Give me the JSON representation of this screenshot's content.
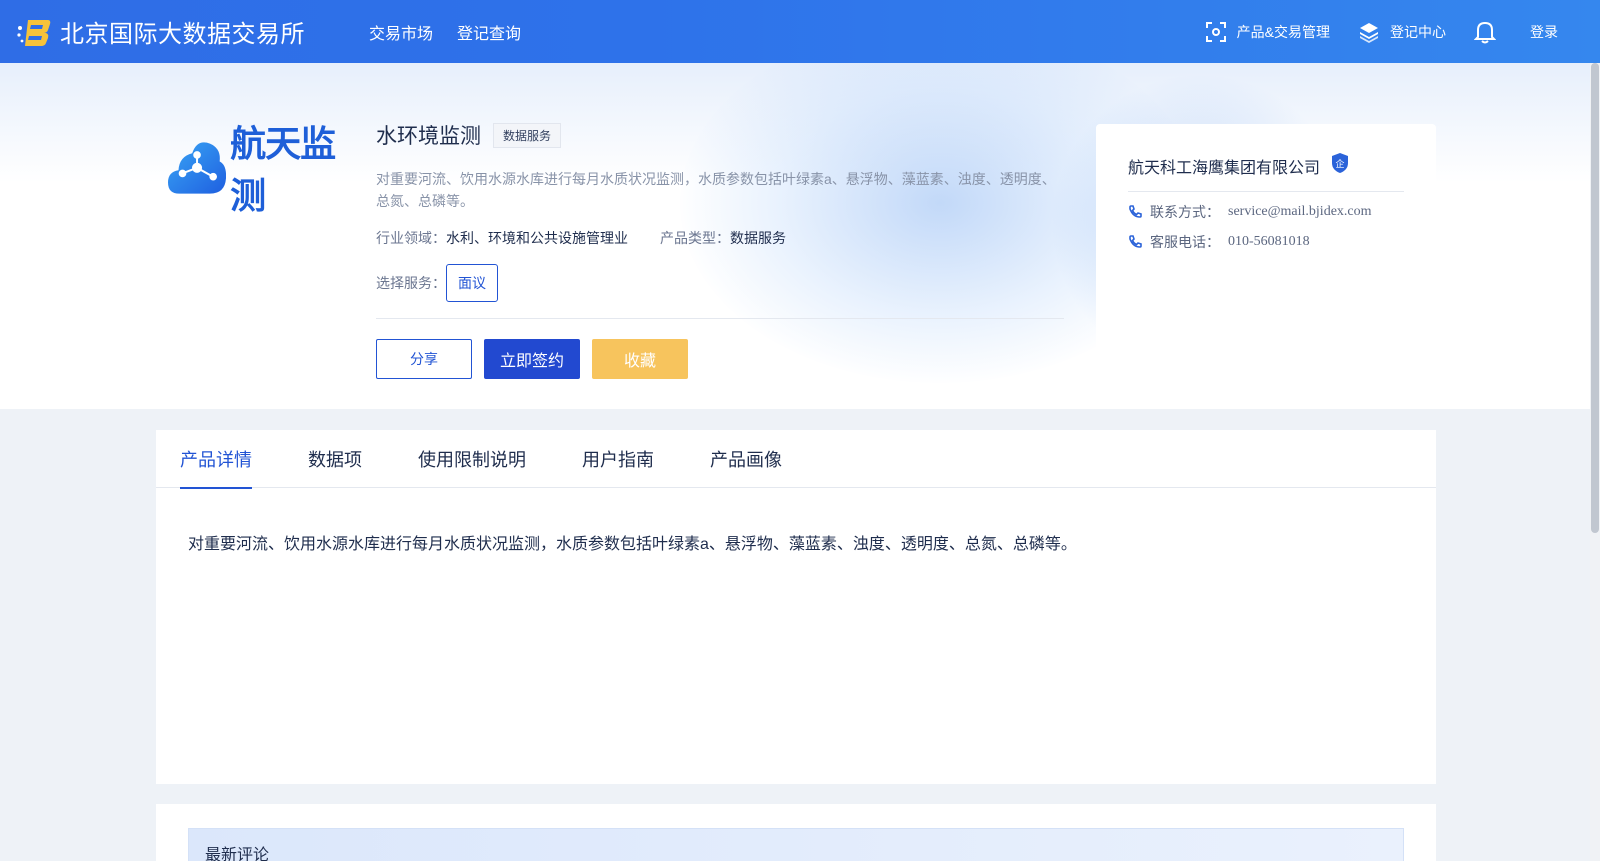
{
  "header": {
    "brand_title": "北京国际大数据交易所",
    "nav": [
      "交易市场",
      "登记查询"
    ],
    "right_items": {
      "product_mgmt": "产品&交易管理",
      "register_center": "登记中心",
      "login": "登录"
    }
  },
  "product": {
    "logo_text": "航天监测",
    "title": "水环境监测",
    "tag": "数据服务",
    "description": "对重要河流、饮用水源水库进行每月水质状况监测，水质参数包括叶绿素a、悬浮物、藻蓝素、浊度、透明度、总氮、总磷等。",
    "industry_label": "行业领域：",
    "industry_value": "水利、环境和公共设施管理业",
    "type_label": "产品类型：",
    "type_value": "数据服务",
    "service_label": "选择服务：",
    "service_option": "面议",
    "actions": {
      "share": "分享",
      "sign": "立即签约",
      "favorite": "收藏"
    }
  },
  "company": {
    "name": "航天科工海鹰集团有限公司",
    "badge": "企",
    "contact_label": "联系方式：",
    "contact_value": "service@mail.bjidex.com",
    "phone_label": "客服电话：",
    "phone_value": "010-56081018"
  },
  "tabs": {
    "items": [
      "产品详情",
      "数据项",
      "使用限制说明",
      "用户指南",
      "产品画像"
    ],
    "active_index": 0,
    "content": "对重要河流、饮用水源水库进行每月水质状况监测，水质参数包括叶绿素a、悬浮物、藻蓝素、浊度、透明度、总氮、总磷等。"
  },
  "comments": {
    "title": "最新评论"
  },
  "colors": {
    "header_blue": "#2f6de6",
    "primary": "#2254d4",
    "favorite_yellow": "#f7c45d",
    "page_bg": "#eef2f7"
  }
}
